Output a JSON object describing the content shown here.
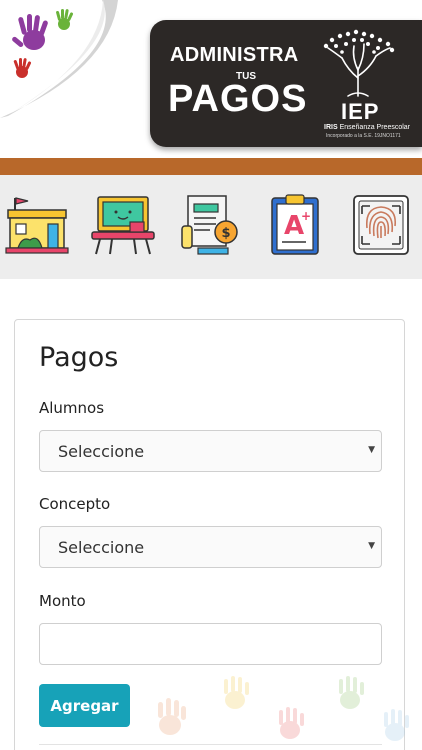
{
  "header": {
    "banner_line1": "ADMINISTRA",
    "banner_line2": "TUS",
    "banner_line3": "PAGOS",
    "logo_text": "IEP",
    "school_name_bold": "IRIS",
    "school_name_rest": "Enseñanza Preescolar",
    "incorporation": "Incorporado a la S.E. 19JNO1171",
    "colors": {
      "banner_bg": "#2c2826",
      "stripe": "#b8682a"
    }
  },
  "nav": {
    "icons": [
      {
        "name": "school-icon"
      },
      {
        "name": "classroom-desk-icon"
      },
      {
        "name": "payment-receipt-icon"
      },
      {
        "name": "grade-clipboard-icon"
      },
      {
        "name": "fingerprint-icon"
      }
    ]
  },
  "form": {
    "title": "Pagos",
    "alumnos_label": "Alumnos",
    "alumnos_value": "Seleccione",
    "concepto_label": "Concepto",
    "concepto_value": "Seleccione",
    "monto_label": "Monto",
    "monto_value": "",
    "submit_label": "Agregar",
    "accent": "#17a2b8"
  }
}
